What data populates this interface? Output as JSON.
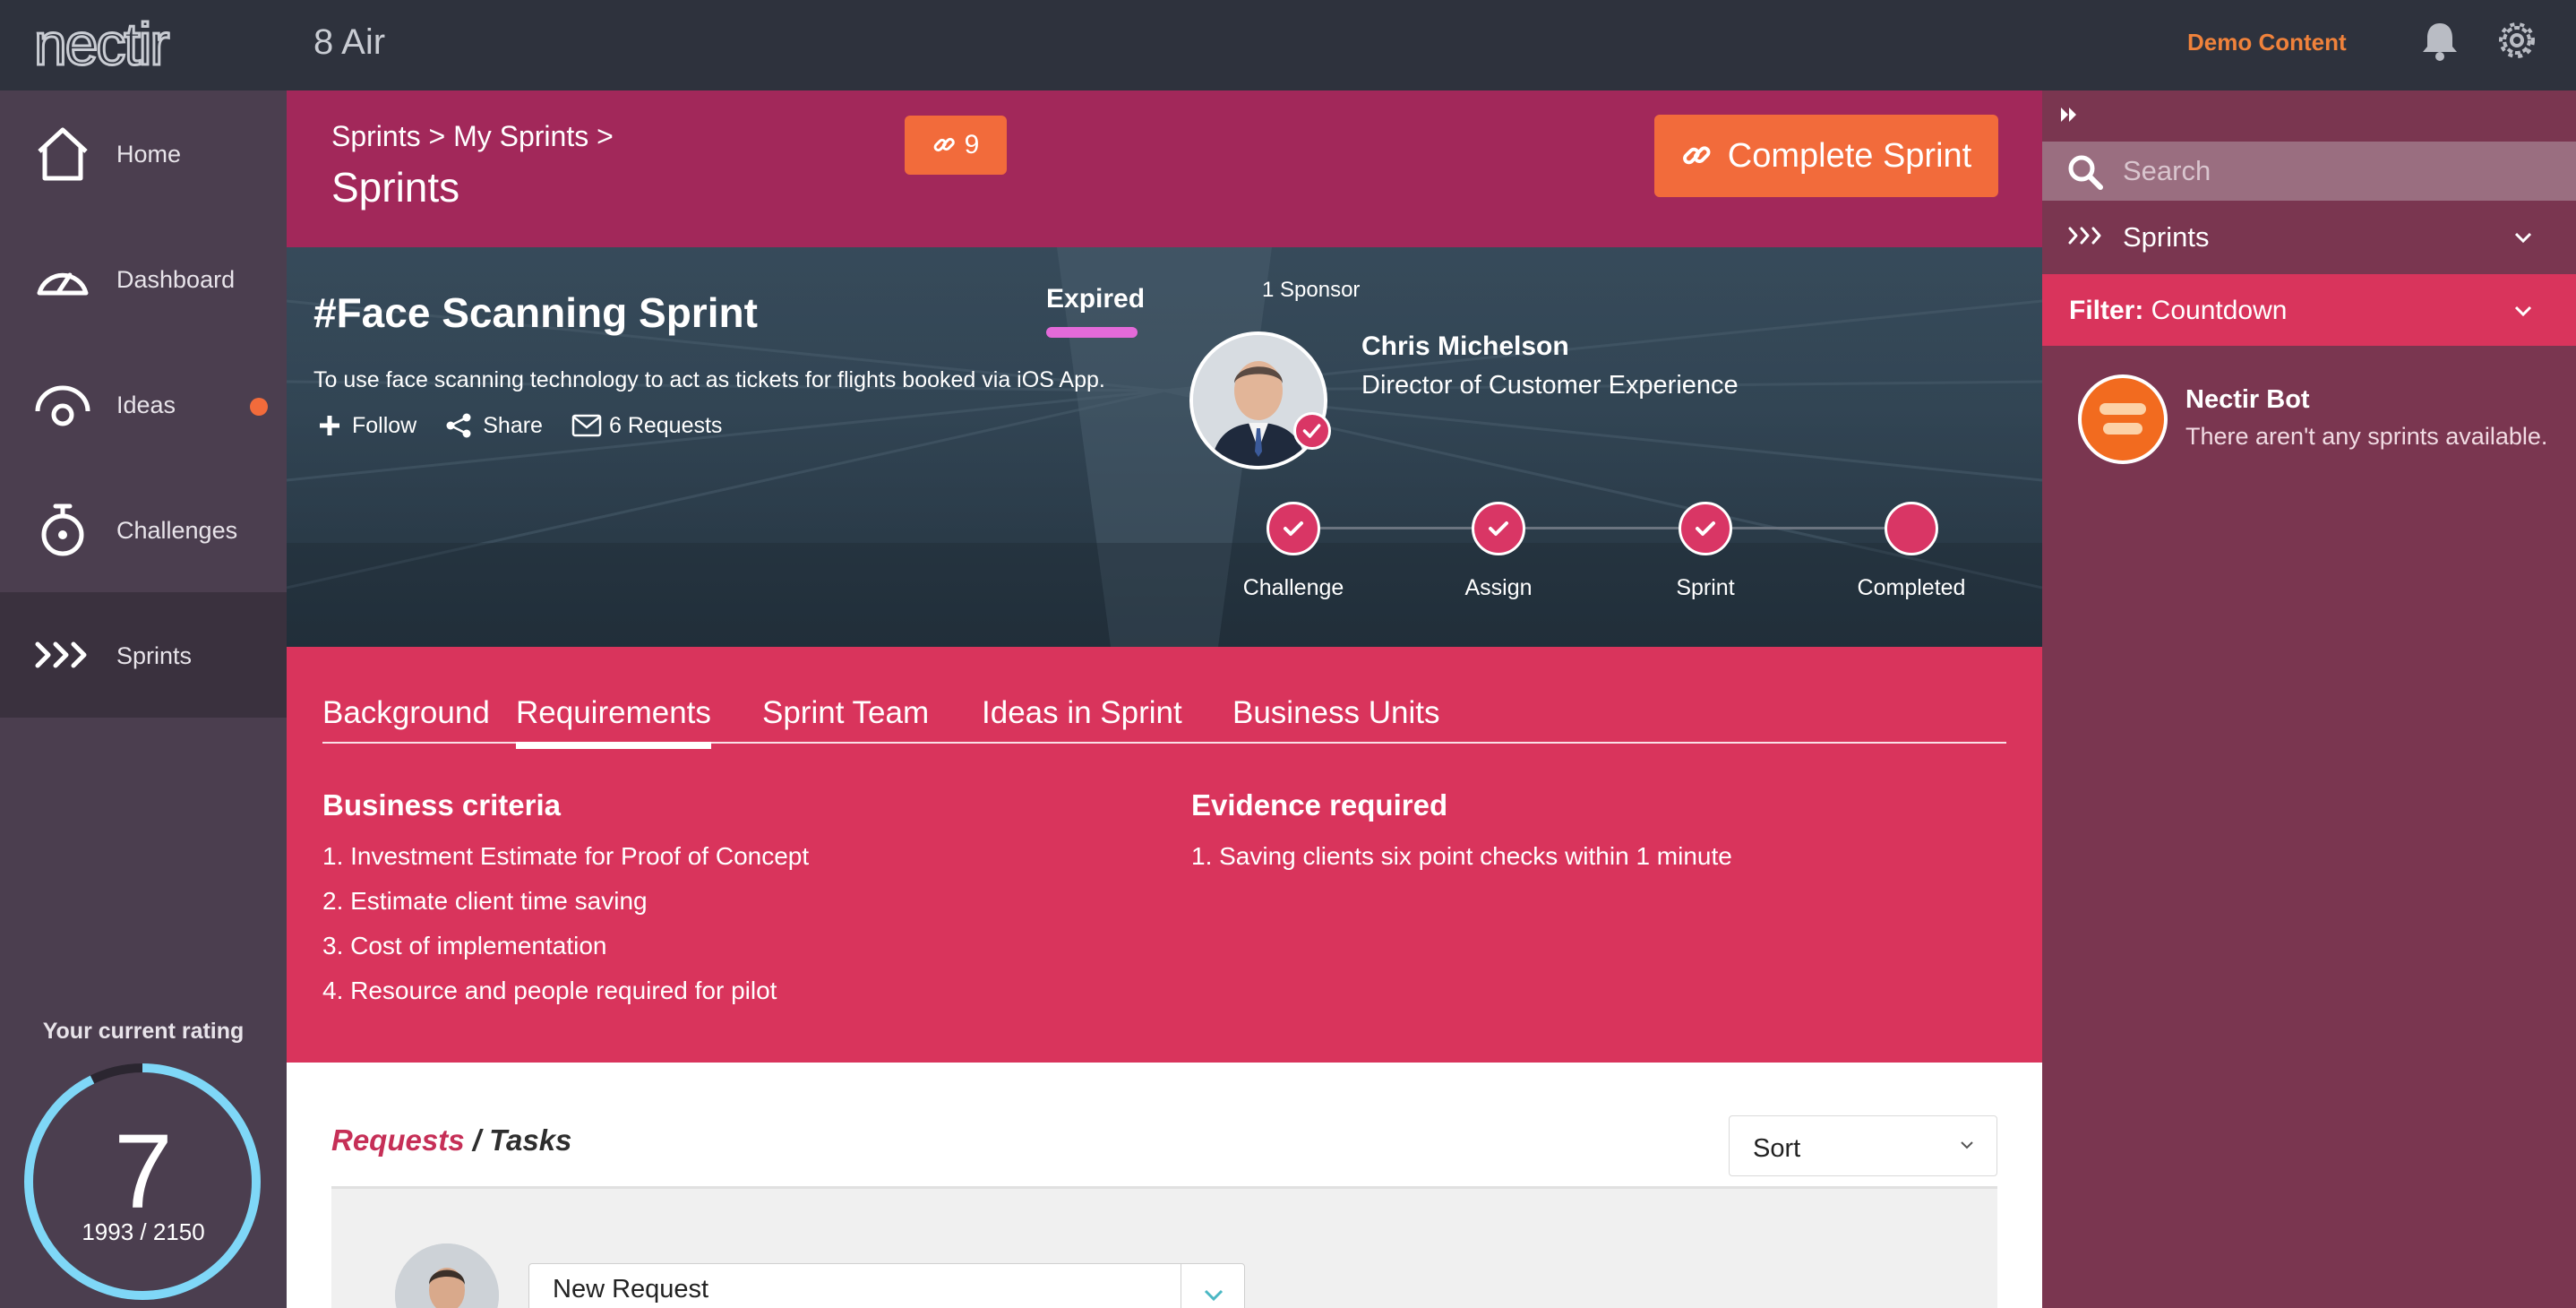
{
  "app": {
    "logo_text": "nectir",
    "company": "8 Air"
  },
  "topbar": {
    "demo_label": "Demo Content",
    "bell_icon": "bell-icon",
    "settings_icon": "gear-icon"
  },
  "nav": {
    "items": [
      {
        "label": "Home",
        "icon": "home-icon"
      },
      {
        "label": "Dashboard",
        "icon": "gauge-icon"
      },
      {
        "label": "Ideas",
        "icon": "idea-icon",
        "has_dot": true
      },
      {
        "label": "Challenges",
        "icon": "stopwatch-icon"
      },
      {
        "label": "Sprints",
        "icon": "sprints-icon",
        "active": true
      }
    ],
    "rating": {
      "label": "Your current rating",
      "value": "7",
      "points": "1993 / 2150",
      "progress": 0.927,
      "ring_color": "#7fd7f7"
    }
  },
  "header": {
    "breadcrumb": "Sprints > My Sprints >",
    "title": "Sprints",
    "link_count": "9",
    "complete_button": "Complete Sprint"
  },
  "sprint": {
    "title": "#Face Scanning Sprint",
    "description": "To use face scanning technology to act as tickets for flights booked via iOS App.",
    "follow": "Follow",
    "share": "Share",
    "requests": "6 Requests",
    "status": "Expired",
    "status_color": "#e36ad9",
    "sponsor_count": "1 Sponsor",
    "sponsor_name": "Chris Michelson",
    "sponsor_role": "Director of Customer Experience",
    "steps": [
      {
        "label": "Challenge",
        "done": true
      },
      {
        "label": "Assign",
        "done": true
      },
      {
        "label": "Sprint",
        "done": true
      },
      {
        "label": "Completed",
        "done": false
      }
    ]
  },
  "tabs": [
    "Background",
    "Requirements",
    "Sprint Team",
    "Ideas in Sprint",
    "Business Units"
  ],
  "active_tab": "Requirements",
  "requirements": {
    "business_title": "Business criteria",
    "business_items": [
      "1. Investment Estimate for Proof of Concept",
      "2. Estimate client time saving",
      "3. Cost of implementation",
      "4. Resource and people required for pilot"
    ],
    "evidence_title": "Evidence required",
    "evidence_items": [
      "1. Saving clients six point checks within 1 minute"
    ]
  },
  "requests_section": {
    "title_primary": "Requests",
    "title_secondary": " / Tasks",
    "sort_label": "Sort",
    "new_request": "New Request"
  },
  "right_panel": {
    "search_placeholder": "Search",
    "sprints_label": "Sprints",
    "filter_prefix": "Filter:",
    "filter_value": " Countdown",
    "bot_name": "Nectir Bot",
    "bot_message": "There aren't any sprints available."
  },
  "colors": {
    "accent": "#f26b3b",
    "brand_pink": "#d9345c",
    "header_magenta": "#a2285a",
    "panel": "#7a3650",
    "demo": "#f0823b"
  }
}
